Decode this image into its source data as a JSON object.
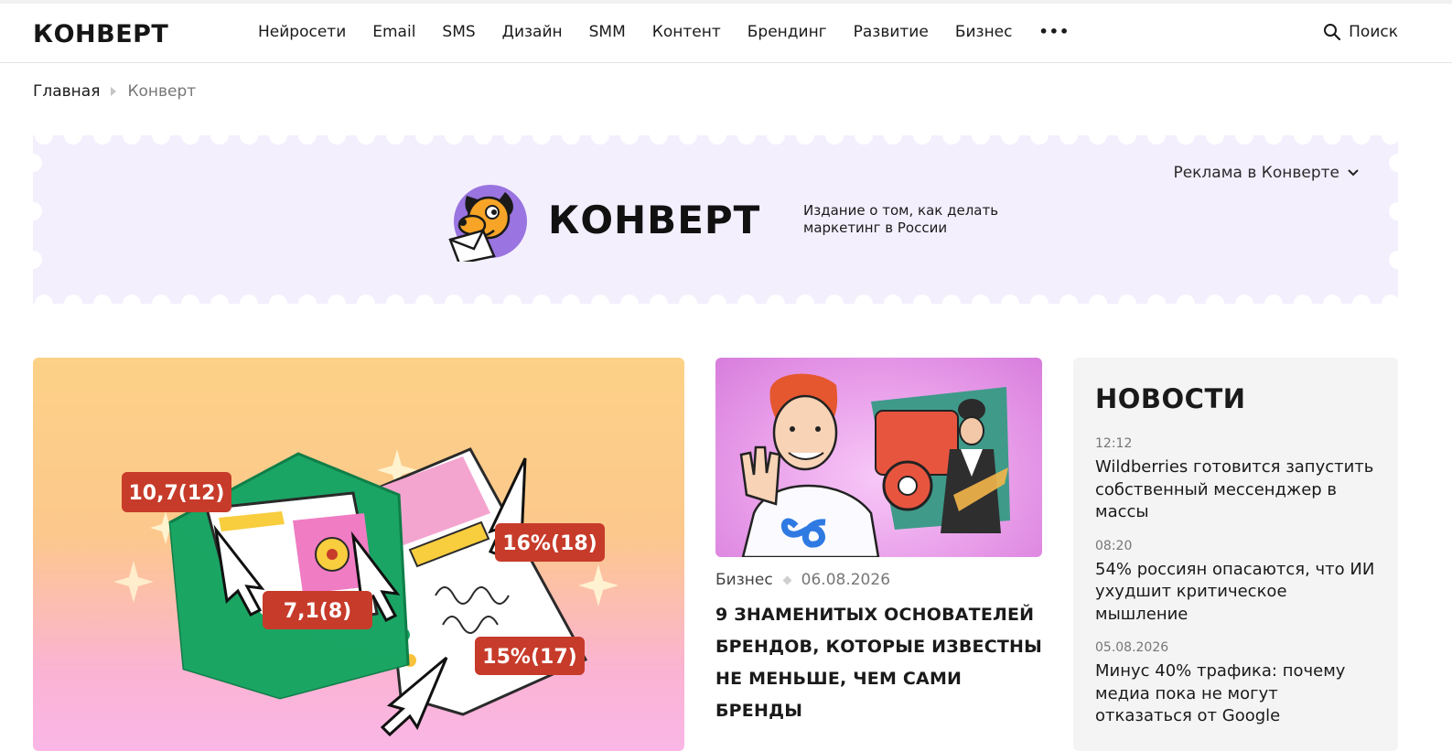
{
  "header": {
    "logo": "КОНВЕРТ",
    "nav": [
      "Нейросети",
      "Email",
      "SMS",
      "Дизайн",
      "SMM",
      "Контент",
      "Брендинг",
      "Развитие",
      "Бизнес"
    ],
    "more": "•••",
    "search_label": "Поиск"
  },
  "breadcrumb": {
    "home": "Главная",
    "current": "Конверт"
  },
  "banner": {
    "ad_label": "Реклама в Конверте",
    "title": "КОНВЕРТ",
    "tagline": "Издание о том, как делать маркетинг в России"
  },
  "main_card": {
    "badges": [
      "10,7(12)",
      "16%(18)",
      "7,1(8)",
      "15%(17)"
    ]
  },
  "feature": {
    "category": "Бизнес",
    "date": "06.08.2026",
    "title": "9 знаменитых основателей брендов, которые известны не меньше, чем сами бренды"
  },
  "news": {
    "heading": "НОВОСТИ",
    "items": [
      {
        "time": "12:12",
        "text": "Wildberries готовится запустить собственный мессенджер в массы"
      },
      {
        "time": "08:20",
        "text": "54% россиян опасаются, что ИИ ухудшит критическое мышление"
      },
      {
        "time": "05.08.2026",
        "text": "Минус 40% трафика: почему медиа пока не могут отказаться от Google"
      }
    ]
  },
  "colors": {
    "banner_bg": "#f3effd",
    "badge_red": "#c73b2a",
    "envelope_green": "#1aa564",
    "news_bg": "#f4f4f4"
  }
}
